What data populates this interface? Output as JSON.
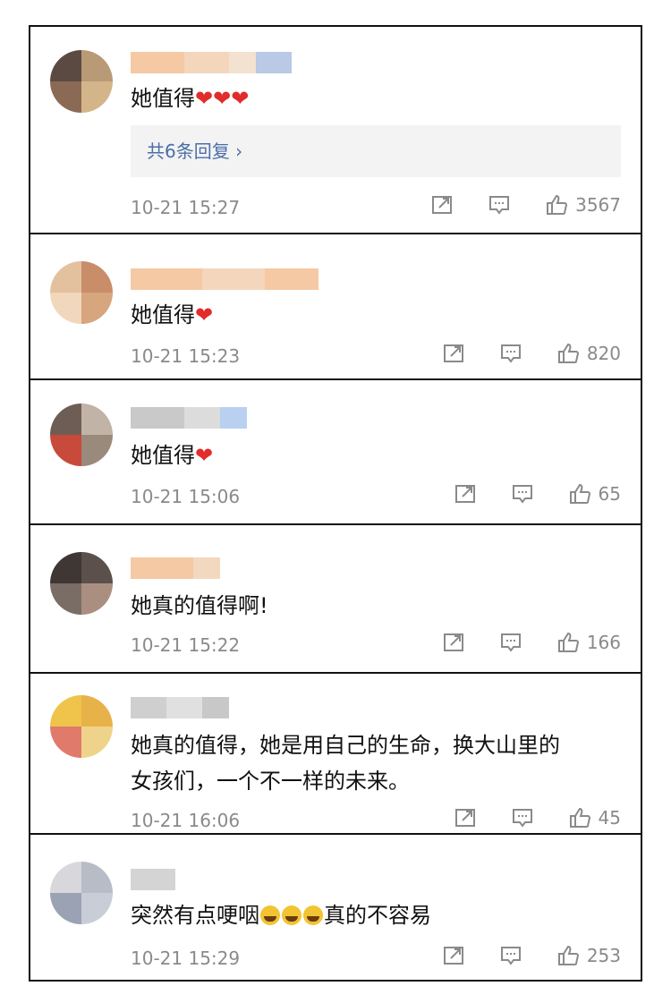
{
  "comments": [
    {
      "text": "她值得",
      "hearts": 3,
      "time": "10-21 15:27",
      "likes": "3567",
      "replies": "共6条回复 ›"
    },
    {
      "text": "她值得",
      "hearts": 1,
      "time": "10-21 15:23",
      "likes": "820"
    },
    {
      "text": "她值得",
      "hearts": 1,
      "time": "10-21 15:06",
      "likes": "65"
    },
    {
      "text": "她真的值得啊!",
      "time": "10-21 15:22",
      "likes": "166"
    },
    {
      "text_line1": "她真的值得，她是用自己的生命，换大山里的",
      "text_line2": "女孩们，一个不一样的未来。",
      "time": "10-21 16:06",
      "likes": "45"
    },
    {
      "text_before": "突然有点哽咽",
      "text_after": "真的不容易",
      "emoji_count": 3,
      "time": "10-21 15:29",
      "likes": "253"
    }
  ],
  "icons": [
    "share-icon",
    "comment-icon",
    "thumbs-up-icon",
    "heart-icon",
    "crying-emoji-icon"
  ],
  "colors": {
    "heart": "#e22b2b",
    "reply_link": "#4b6fa8",
    "meta": "#8a8a8a",
    "border": "#111111"
  }
}
